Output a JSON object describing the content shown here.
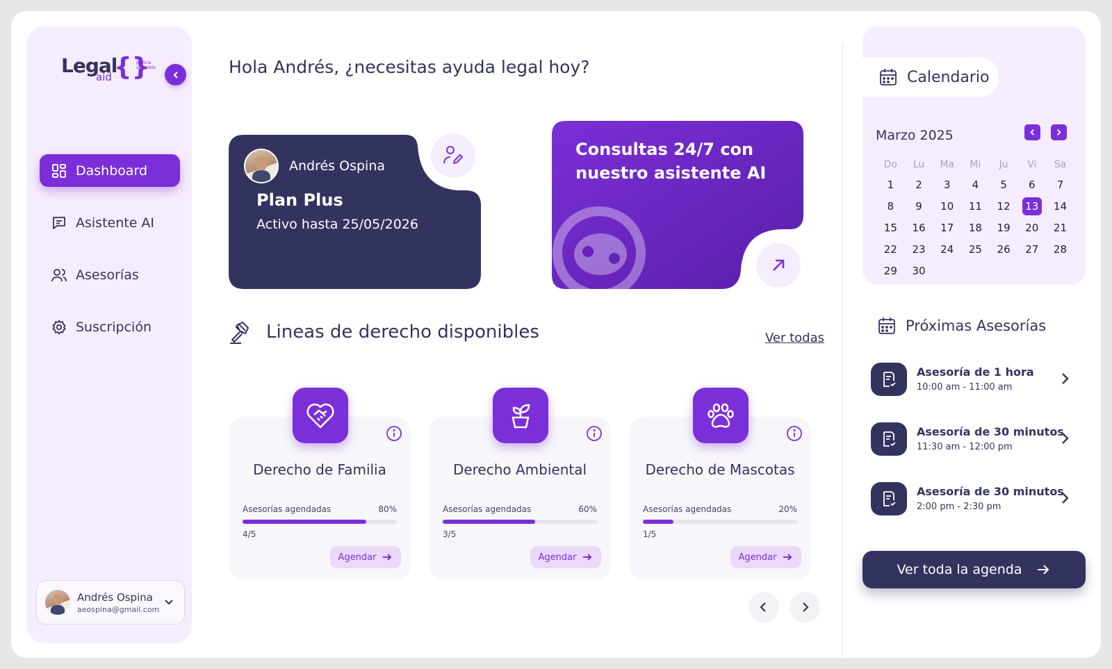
{
  "brand": {
    "name": "Legal",
    "sub": "aid",
    "tagline": "Justicia accesible"
  },
  "sidebar": {
    "items": [
      {
        "label": "Dashboard",
        "icon": "dashboard-icon",
        "active": true
      },
      {
        "label": "Asistente AI",
        "icon": "chat-icon",
        "active": false
      },
      {
        "label": "Asesorías",
        "icon": "users-icon",
        "active": false
      },
      {
        "label": "Suscripción",
        "icon": "gear-icon",
        "active": false
      }
    ],
    "user": {
      "name": "Andrés Ospina",
      "email": "aeospina@gmail.com"
    }
  },
  "main": {
    "greeting": "Hola Andrés, ¿necesitas ayuda legal hoy?",
    "plan": {
      "user": "Andrés Ospina",
      "title": "Plan Plus",
      "subtitle": "Activo hasta 25/05/2026"
    },
    "ai": {
      "title": "Consultas 24/7 con nuestro asistente AI"
    },
    "section": {
      "title": "Lineas de derecho disponibles",
      "see_all": "Ver todas"
    },
    "cards": [
      {
        "name": "Derecho de Familia",
        "meta_label": "Asesorías agendadas",
        "percent": "80%",
        "fraction": 0.8,
        "count": "4/5",
        "button": "Agendar",
        "icon": "heart-handshake-icon"
      },
      {
        "name": "Derecho Ambiental",
        "meta_label": "Asesorías agendadas",
        "percent": "60%",
        "fraction": 0.6,
        "count": "3/5",
        "button": "Agendar",
        "icon": "plant-icon"
      },
      {
        "name": "Derecho de Mascotas",
        "meta_label": "Asesorías agendadas",
        "percent": "20%",
        "fraction": 0.2,
        "count": "1/5",
        "button": "Agendar",
        "icon": "paw-icon"
      }
    ]
  },
  "calendar": {
    "label": "Calendario",
    "month": "Marzo 2025",
    "weekdays": [
      "Do",
      "Lu",
      "Ma",
      "Mi",
      "Ju",
      "Vi",
      "Sa"
    ],
    "days": [
      "1",
      "2",
      "3",
      "4",
      "5",
      "6",
      "7",
      "8",
      "9",
      "10",
      "11",
      "12",
      "13",
      "14",
      "15",
      "16",
      "17",
      "18",
      "19",
      "20",
      "21",
      "22",
      "23",
      "24",
      "25",
      "26",
      "27",
      "28",
      "29",
      "30"
    ],
    "selected": "13"
  },
  "upcoming": {
    "title": "Próximas Asesorías",
    "items": [
      {
        "name": "Asesoría de 1 hora",
        "time": "10:00 am - 11:00 am"
      },
      {
        "name": "Asesoría de 30 minutos",
        "time": "11:30 am - 12:00 pm"
      },
      {
        "name": "Asesoría de 30 minutos",
        "time": "2:00 pm - 2:30 pm"
      }
    ],
    "button": "Ver toda la agenda"
  },
  "colors": {
    "primary": "#7b2fd8",
    "navy": "#33335f",
    "lavender": "#f5edfd"
  }
}
